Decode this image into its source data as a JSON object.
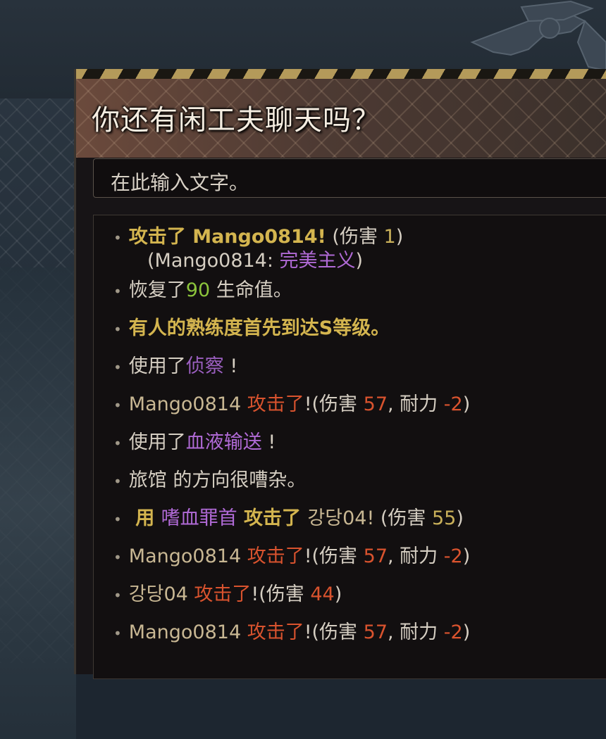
{
  "dialog": {
    "title": "你还有闲工夫聊天吗？",
    "input_placeholder": "在此输入文字。"
  },
  "chat_log": [
    {
      "parts": [
        {
          "t": "攻击了 Mango0814!",
          "c": "c-gold-b"
        },
        {
          "t": " (伤害 ",
          "c": "c-white"
        },
        {
          "t": "1",
          "c": "c-gold"
        },
        {
          "t": ")",
          "c": "c-white"
        }
      ],
      "sub": [
        {
          "t": "(Mango0814: ",
          "c": "c-white"
        },
        {
          "t": "完美主义",
          "c": "c-purple"
        },
        {
          "t": ")",
          "c": "c-white"
        }
      ]
    },
    {
      "parts": [
        {
          "t": "恢复了",
          "c": "c-white"
        },
        {
          "t": "90",
          "c": "c-green"
        },
        {
          "t": " 生命值。",
          "c": "c-white"
        }
      ]
    },
    {
      "parts": [
        {
          "t": "有人的熟练度首先到达S等级。",
          "c": "c-gold-b"
        }
      ]
    },
    {
      "parts": [
        {
          "t": "使用了",
          "c": "c-white"
        },
        {
          "t": "侦察",
          "c": "c-purple-d"
        },
        {
          "t": "  !",
          "c": "c-white"
        }
      ]
    },
    {
      "parts": [
        {
          "t": "Mango0814  ",
          "c": "c-tan"
        },
        {
          "t": "攻击了",
          "c": "c-orange"
        },
        {
          "t": "!(伤害 ",
          "c": "c-white"
        },
        {
          "t": "57",
          "c": "c-orange"
        },
        {
          "t": ",  耐力  ",
          "c": "c-white"
        },
        {
          "t": "-2",
          "c": "c-orange"
        },
        {
          "t": ")",
          "c": "c-white"
        }
      ]
    },
    {
      "parts": [
        {
          "t": "使用了",
          "c": "c-white"
        },
        {
          "t": "血液输送",
          "c": "c-purple"
        },
        {
          "t": "  !",
          "c": "c-white"
        }
      ]
    },
    {
      "parts": [
        {
          "t": "旅馆 的方向很嘈杂。",
          "c": "c-white"
        }
      ]
    },
    {
      "parts": [
        {
          "t": " 用 ",
          "c": "c-gold-b"
        },
        {
          "t": "嗜血罪首",
          "c": "c-purple"
        },
        {
          "t": " 攻击了  ",
          "c": "c-gold-b"
        },
        {
          "t": "강당04!",
          "c": "c-tan"
        },
        {
          "t": " (伤害 ",
          "c": "c-white"
        },
        {
          "t": "55",
          "c": "c-gold"
        },
        {
          "t": ")",
          "c": "c-white"
        }
      ]
    },
    {
      "parts": [
        {
          "t": "Mango0814  ",
          "c": "c-tan"
        },
        {
          "t": "攻击了",
          "c": "c-orange"
        },
        {
          "t": "!(伤害 ",
          "c": "c-white"
        },
        {
          "t": "57",
          "c": "c-orange"
        },
        {
          "t": ",  耐力  ",
          "c": "c-white"
        },
        {
          "t": "-2",
          "c": "c-orange"
        },
        {
          "t": ")",
          "c": "c-white"
        }
      ]
    },
    {
      "parts": [
        {
          "t": "강당04  ",
          "c": "c-tan"
        },
        {
          "t": "攻击了",
          "c": "c-orange"
        },
        {
          "t": "!(伤害 ",
          "c": "c-white"
        },
        {
          "t": "44",
          "c": "c-orange"
        },
        {
          "t": ")",
          "c": "c-white"
        }
      ]
    },
    {
      "parts": [
        {
          "t": "Mango0814  ",
          "c": "c-tan"
        },
        {
          "t": "攻击了",
          "c": "c-orange"
        },
        {
          "t": "!(伤害 ",
          "c": "c-white"
        },
        {
          "t": "57",
          "c": "c-orange"
        },
        {
          "t": ",  耐力  ",
          "c": "c-white"
        },
        {
          "t": "-2",
          "c": "c-orange"
        },
        {
          "t": ")",
          "c": "c-white"
        }
      ]
    }
  ]
}
